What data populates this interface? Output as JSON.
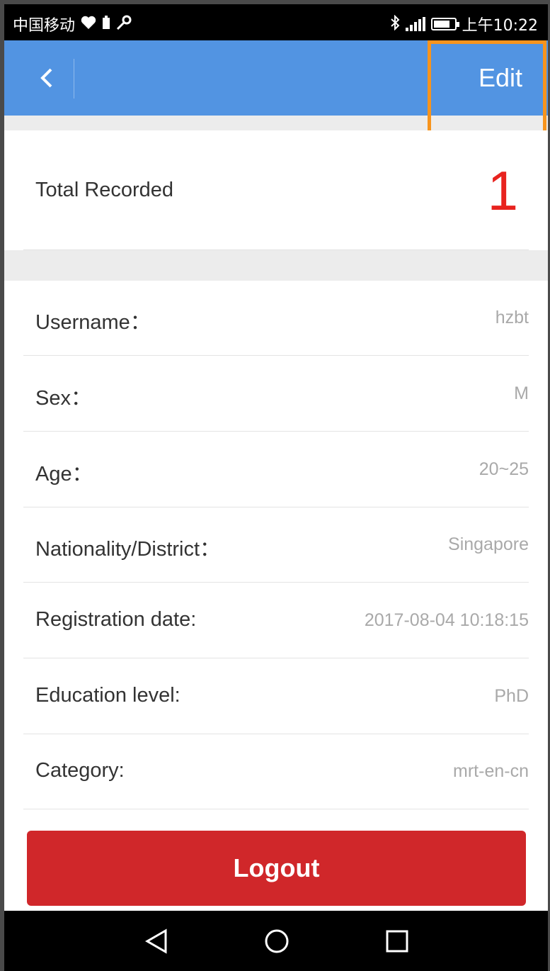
{
  "status_bar": {
    "carrier": "中国移动",
    "time": "上午10:22",
    "battery_fraction": 0.8
  },
  "nav": {
    "back_icon": "chevron-left-icon",
    "edit_label": "Edit"
  },
  "total": {
    "label": "Total Recorded",
    "value": "1"
  },
  "profile": {
    "rows": [
      {
        "label": "Username：",
        "value": "hzbt"
      },
      {
        "label": "Sex：",
        "value": "M"
      },
      {
        "label": "Age：",
        "value": "20~25"
      },
      {
        "label": "Nationality/District：",
        "value": "Singapore"
      },
      {
        "label": "Registration date:",
        "value": "2017-08-04 10:18:15"
      },
      {
        "label": "Education level:",
        "value": "PhD"
      },
      {
        "label": "Category:",
        "value": "mrt-en-cn"
      }
    ]
  },
  "logout_label": "Logout",
  "colors": {
    "nav_blue": "#5294e2",
    "logout_red": "#d0272a",
    "highlight_orange": "#f7941d",
    "total_red": "#e8231f"
  },
  "system_nav": {
    "icons": [
      "back-triangle-icon",
      "home-circle-icon",
      "recents-square-icon"
    ]
  }
}
